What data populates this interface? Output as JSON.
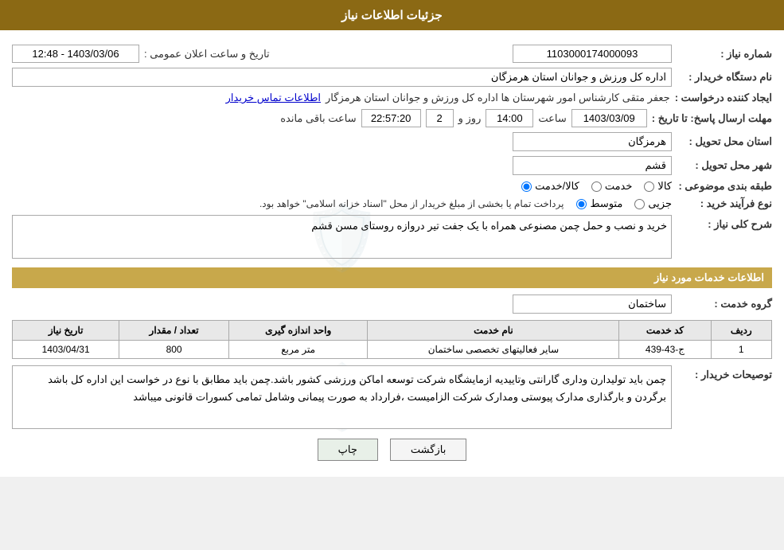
{
  "header": {
    "title": "جزئیات اطلاعات نیاز"
  },
  "labels": {
    "request_number": "شماره نیاز :",
    "buyer_org": "نام دستگاه خریدار :",
    "requester": "ایجاد کننده درخواست :",
    "send_deadline": "مهلت ارسال پاسخ: تا تاریخ :",
    "delivery_province": "استان محل تحویل :",
    "delivery_city": "شهر محل تحویل :",
    "category": "طبقه بندی موضوعی :",
    "process_type": "نوع فرآیند خرید :",
    "description": "شرح کلی نیاز :",
    "service_info": "اطلاعات خدمات مورد نیاز",
    "service_group": "گروه خدمت :",
    "buyer_notes": "توصیحات خریدار :",
    "announcement_date": "تاریخ و ساعت اعلان عمومی :"
  },
  "values": {
    "request_number": "1103000174000093",
    "buyer_org": "اداره کل ورزش و جوانان استان هرمزگان",
    "requester_name": "جعفر متقی کارشناس امور شهرستان ها اداره کل ورزش و جوانان استان هرمزگار",
    "requester_link": "اطلاعات تماس خریدار",
    "announcement_date": "1403/03/06 - 12:48",
    "send_deadline_date": "1403/03/09",
    "send_deadline_time": "14:00",
    "send_deadline_days": "2",
    "send_deadline_remaining": "22:57:20",
    "delivery_province": "هرمزگان",
    "delivery_city": "قشم",
    "category_goods": "کالا",
    "category_service": "خدمت",
    "category_goods_service": "کالا/خدمت",
    "process_partial": "جزیی",
    "process_medium": "متوسط",
    "process_note": "پرداخت تمام یا بخشی از مبلغ خریدار از محل \"اسناد خزانه اسلامی\" خواهد بود.",
    "description_text": "خرید و نصب و حمل چمن مصنوعی همراه با یک جفت تیر دروازه روستای مسن قشم",
    "service_group_value": "ساختمان",
    "table": {
      "headers": [
        "ردیف",
        "کد خدمت",
        "نام خدمت",
        "واحد اندازه گیری",
        "تعداد / مقدار",
        "تاریخ نیاز"
      ],
      "rows": [
        {
          "row": "1",
          "code": "ج-43-439",
          "name": "سایر فعالیتهای تخصصی ساختمان",
          "unit": "متر مربع",
          "quantity": "800",
          "date": "1403/04/31"
        }
      ]
    },
    "buyer_notes_text": "چمن باید تولیدارن وداری گارانتی وتاییدیه ازمایشگاه شرکت توسعه اماکن ورزشی کشور باشد.چمن باید مطابق با نوع در خواست این اداره کل باشد برگردن و بارگذاری مدارک پیوستی  ومدارک شرکت الزامیست ،فرارداد به صورت پیمانی وشامل تمامی کسورات قانونی میباشد",
    "btn_back": "بازگشت",
    "btn_print": "چاپ",
    "days_label": "روز و",
    "remaining_label": "ساعت باقی مانده",
    "time_label": "ساعت"
  }
}
